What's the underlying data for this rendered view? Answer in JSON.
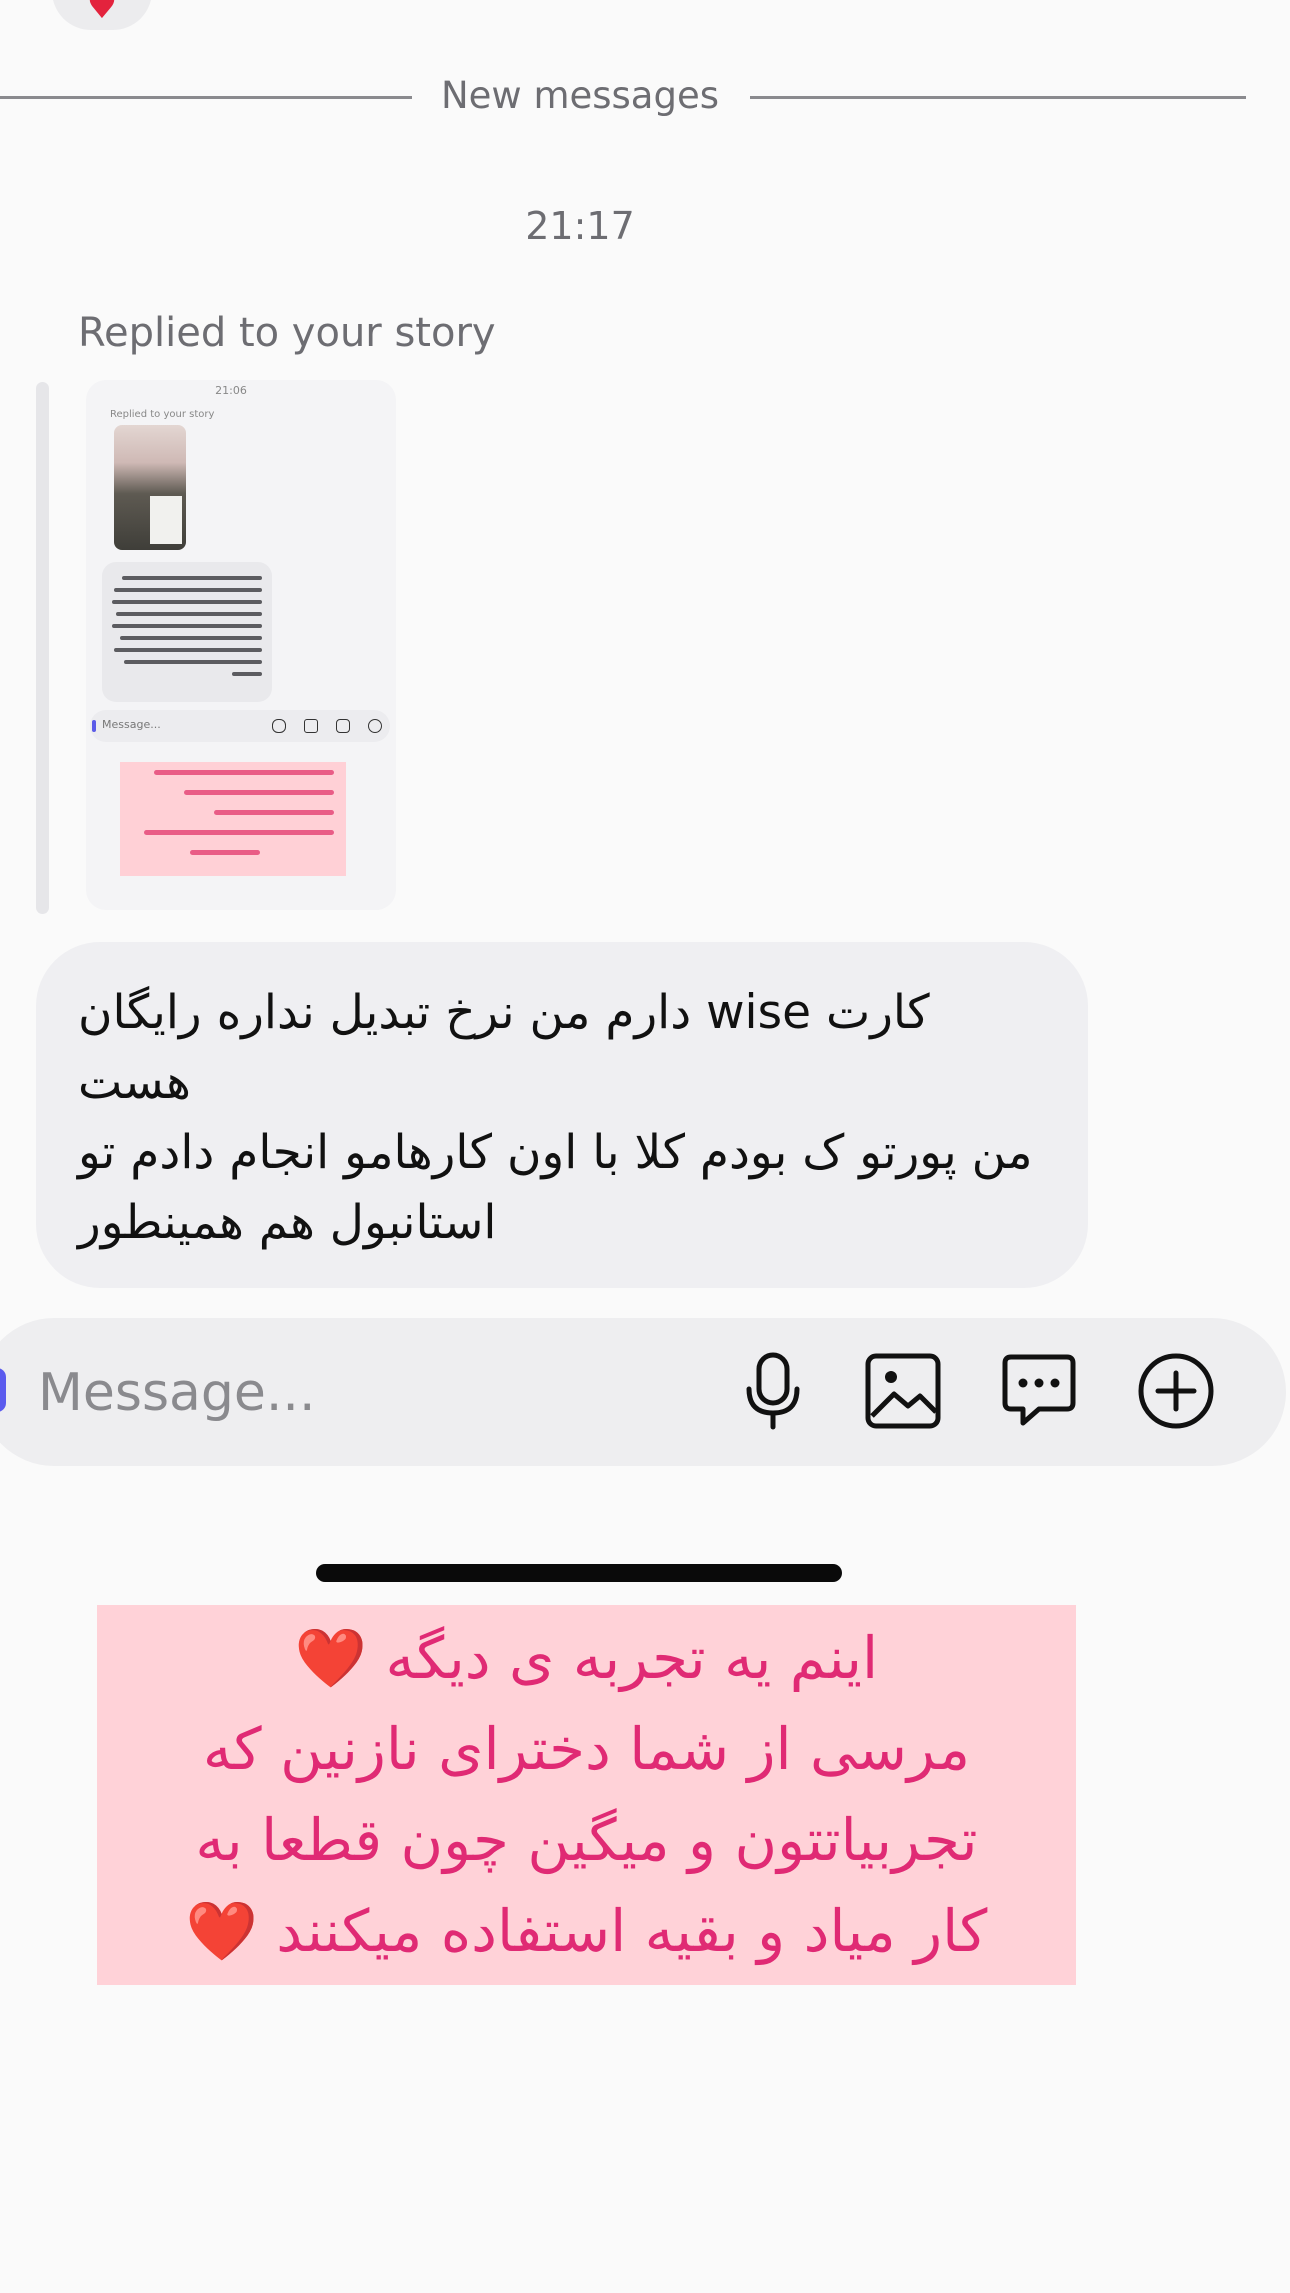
{
  "reaction": {
    "emoji": "♥"
  },
  "divider_label": "New messages",
  "timestamp": "21:17",
  "reply_label": "Replied to your story",
  "story_preview": {
    "time": "21:06",
    "replied": "Replied to your story",
    "message_placeholder": "Message..."
  },
  "message": {
    "text": "کارت wise دارم من نرخ تبدیل نداره رایگان هست\nمن پورتو ک بودم کلا با اون کارهامو انجام دادم تو استانبول هم همینطور"
  },
  "composer": {
    "placeholder": "Message...",
    "icons": [
      "microphone-icon",
      "image-icon",
      "sticker-icon",
      "plus-icon"
    ]
  },
  "caption": {
    "line1": "اینم یه تجربه ی دیگه ❤️",
    "line2": "مرسی از شما دخترای نازنین  که",
    "line3": "تجربیاتتون و میگین چون قطعا به",
    "line4": "کار میاد و بقیه استفاده میکنند ❤️"
  },
  "colors": {
    "accent": "#5b5bee",
    "caption_bg": "#ffd2d8",
    "caption_text": "#e02a74",
    "bubble_bg": "#efeff2"
  }
}
